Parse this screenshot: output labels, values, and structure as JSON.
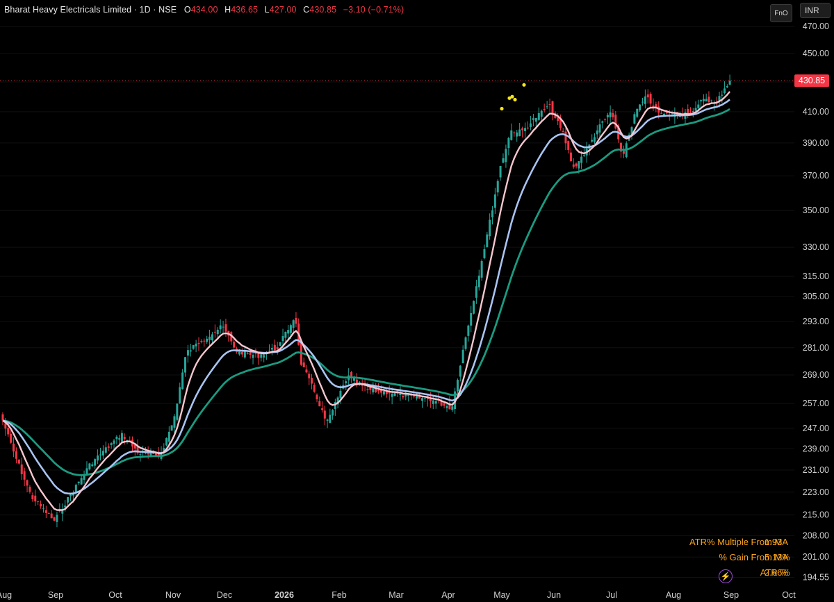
{
  "header": {
    "title": "Bharat Heavy Electricals Limited · 1D · NSE",
    "open_label": "O",
    "open": "434.00",
    "high_label": "H",
    "high": "436.65",
    "low_label": "L",
    "low": "427.00",
    "close_label": "C",
    "close": "430.85",
    "change": "−3.10 (−0.71%)"
  },
  "toolbar": {
    "fno_label": "FnO",
    "currency_label": "INR"
  },
  "stats": {
    "atr_multiple_label": "ATR% Multiple From MA",
    "atr_multiple_value": "1.93",
    "gain_label": "% Gain From MA",
    "gain_value": "5.13%",
    "atr_label": "ATR %",
    "atr_value": "2.66%"
  },
  "colors": {
    "up": "#26a69a",
    "down": "#f23645",
    "ma_fast": "#f7c6cf",
    "ma_mid": "#a9c4f2",
    "ma_slow": "#1a9b80",
    "marker": "#f5e51b"
  },
  "chart_data": {
    "type": "candlestick",
    "title": "Bharat Heavy Electricals Limited · 1D · NSE",
    "y_scale": "log",
    "y_ticks": [
      "470.00",
      "450.00",
      "430.00",
      "410.00",
      "390.00",
      "370.00",
      "350.00",
      "330.00",
      "315.00",
      "305.00",
      "293.00",
      "281.00",
      "269.00",
      "257.00",
      "247.00",
      "239.00",
      "231.00",
      "223.00",
      "215.00",
      "208.00",
      "201.00",
      "194.55"
    ],
    "x_ticks": [
      "Aug",
      "Sep",
      "Oct",
      "Nov",
      "Dec",
      "2026",
      "Feb",
      "Mar",
      "Apr",
      "May",
      "Jun",
      "Jul",
      "Aug",
      "Sep",
      "Oct"
    ],
    "x_ticks_bold": [
      "2026"
    ],
    "last_price": "430.85",
    "series": [
      {
        "name": "close",
        "x": [
          0,
          0.08,
          0.16,
          0.24,
          0.32,
          0.4,
          0.48,
          0.56,
          0.64,
          0.72,
          0.8,
          0.88,
          0.96,
          1
        ],
        "values": [
          250,
          246,
          240,
          228,
          220,
          214,
          212,
          214,
          230,
          238,
          240,
          236,
          232,
          236
        ]
      }
    ],
    "markers": [
      {
        "date": "May",
        "value": 412
      },
      {
        "date": "May",
        "value": 419
      },
      {
        "date": "May",
        "value": 420
      },
      {
        "date": "May",
        "value": 418
      },
      {
        "date": "May",
        "value": 428
      }
    ]
  }
}
